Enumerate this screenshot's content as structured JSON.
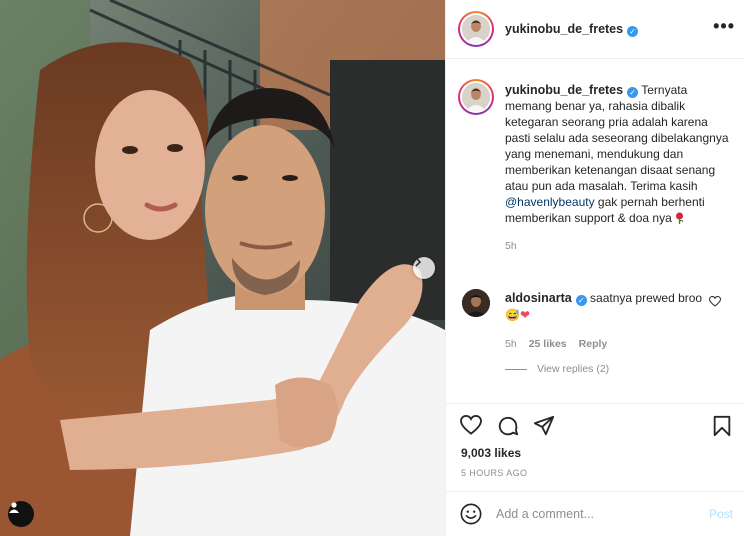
{
  "post": {
    "author": "yukinobu_de_fretes",
    "verified_glyph": "✓",
    "more_label": "•••",
    "caption_before_mention": "Ternyata memang benar ya, rahasia dibalik ketegaran seorang pria adalah karena pasti selalu ada seseorang dibelakangnya yang menemani, mendukung dan memberikan ketenangan disaat senang atau pun ada masalah. Terima kasih ",
    "caption_mention": "@havenlybeauty",
    "caption_after_mention": " gak pernah berhenti memberikan support & doa nya",
    "caption_time": "5h"
  },
  "comment": {
    "author": "aldosinarta",
    "text": "saatnya prewed broo",
    "emoji": "😅",
    "heart_emoji": "❤",
    "time": "5h",
    "likes": "25 likes",
    "reply_label": "Reply",
    "view_replies": "View replies (2)"
  },
  "stats": {
    "likes": "9,003 likes",
    "posted_ago": "5 HOURS AGO"
  },
  "add_comment": {
    "placeholder": "Add a comment...",
    "post_label": "Post"
  },
  "icons": [
    "chevron-right-icon",
    "user-tag-icon",
    "heart-icon",
    "comment-icon",
    "share-icon",
    "bookmark-icon",
    "emoji-icon",
    "rose-icon",
    "verified-badge-icon"
  ],
  "colors": {
    "verified": "#3897f0",
    "mention": "#00376b",
    "post_button": "#b2dffc",
    "meta_text": "#8e8e8e",
    "heart_red": "#ed4956"
  }
}
